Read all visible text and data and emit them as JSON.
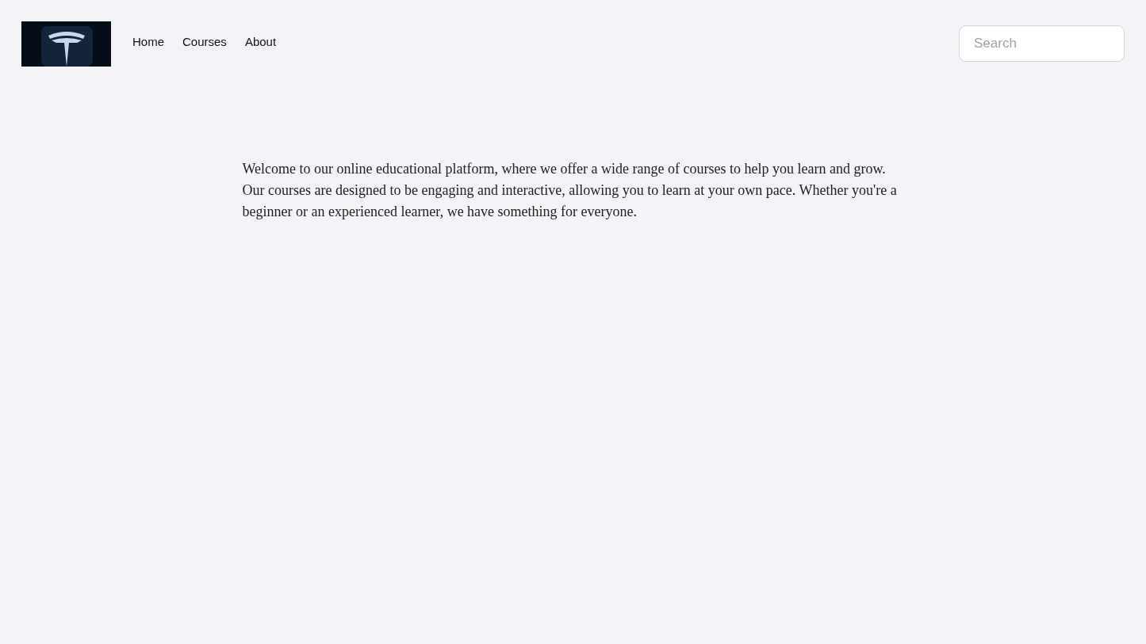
{
  "header": {
    "nav": [
      {
        "label": "Home"
      },
      {
        "label": "Courses"
      },
      {
        "label": "About"
      }
    ],
    "search": {
      "placeholder": "Search"
    }
  },
  "intro": {
    "text": "Welcome to our online educational platform, where we offer a wide range of courses to help you learn and grow. Our courses are designed to be engaging and interactive, allowing you to learn at your own pace. Whether you're a beginner or an experienced learner, we have something for everyone."
  }
}
